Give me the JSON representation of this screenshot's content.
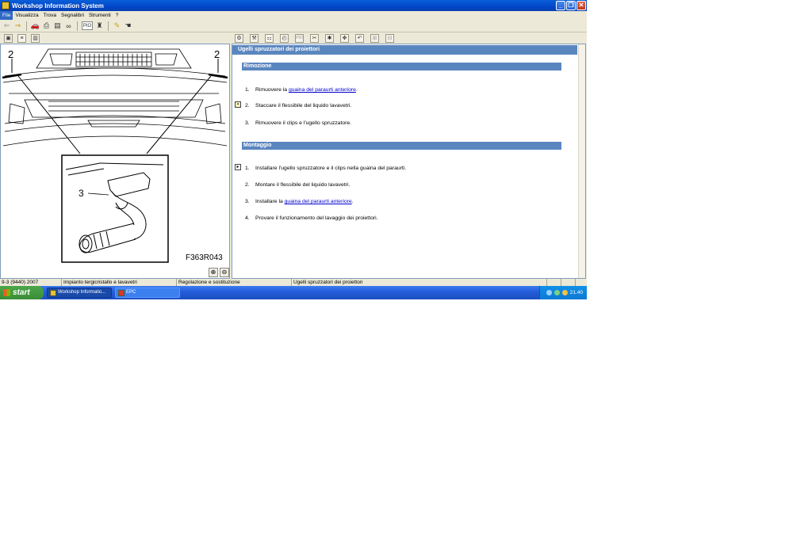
{
  "window": {
    "title": "Workshop Information System"
  },
  "menu": [
    {
      "label": "File",
      "active": true
    },
    {
      "label": "Visualizza"
    },
    {
      "label": "Trova"
    },
    {
      "label": "Segnalibri"
    },
    {
      "label": "Strumenti"
    },
    {
      "label": "?"
    }
  ],
  "toolbar": {
    "pio_label": "PIO"
  },
  "figure": {
    "callout_left": "2",
    "callout_right": "2",
    "callout_detail": "3",
    "figure_id": "F363R043"
  },
  "document": {
    "title": "Ugelli spruzzatori dei proiettori",
    "sections": [
      {
        "heading": "Rimozione",
        "steps": [
          {
            "num": "1.",
            "pre": "Rimuovere la ",
            "link": "guaina del paraurti anteriore",
            "post": "."
          },
          {
            "num": "2.",
            "pre": "Staccare il flessibile del liquido lavavetri.",
            "link": "",
            "post": ""
          },
          {
            "num": "3.",
            "pre": "Rimuovere il clips e l'ugello spruzzatore.",
            "link": "",
            "post": ""
          }
        ]
      },
      {
        "heading": "Montaggio",
        "steps": [
          {
            "num": "1.",
            "pre": "Installare l'ugello spruzzatore e il clips nella guaina del paraurti.",
            "link": "",
            "post": ""
          },
          {
            "num": "2.",
            "pre": "Montare il flessibile del liquido lavavetri.",
            "link": "",
            "post": ""
          },
          {
            "num": "3.",
            "pre": "Installare la ",
            "link": "guaina del paraurti anteriore",
            "post": "."
          },
          {
            "num": "4.",
            "pre": "Provare il funzionamento del lavaggio dei proiettori.",
            "link": "",
            "post": ""
          }
        ]
      }
    ]
  },
  "status": {
    "model": "9-3 (9440) 2007",
    "system": "Impianto tergicristallo e lavavetri",
    "category": "Regolazione e sostituzione",
    "topic": "Ugelli spruzzatori dei proiettori"
  },
  "taskbar": {
    "start": "start",
    "tasks": [
      {
        "label": "Workshop Informatio...",
        "active": false
      },
      {
        "label": "EPC",
        "active": true
      }
    ],
    "clock": "21.40"
  }
}
